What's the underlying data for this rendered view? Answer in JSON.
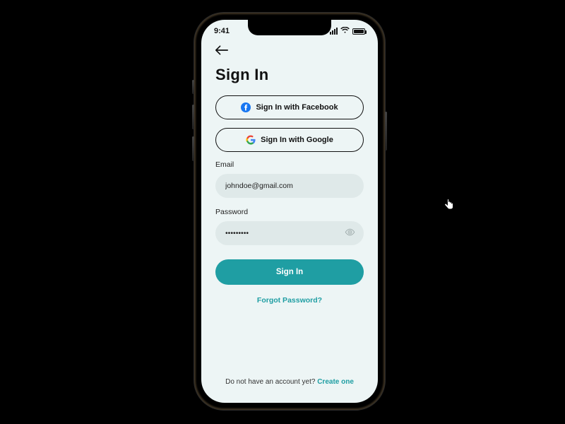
{
  "status": {
    "time": "9:41"
  },
  "page_title": "Sign In",
  "oauth": {
    "facebook_label": "Sign In with Facebook",
    "google_label": "Sign In with Google"
  },
  "form": {
    "email_label": "Email",
    "email_value": "johndoe@gmail.com",
    "password_label": "Password",
    "password_value": "•••••••••"
  },
  "primary_button": "Sign In",
  "forgot_link": "Forgot Password?",
  "signup_prompt": "Do not have an account yet? ",
  "signup_link": "Create one",
  "colors": {
    "accent": "#1f9ea3",
    "screen_bg": "#edf5f5",
    "input_bg": "#dfe9e9"
  }
}
